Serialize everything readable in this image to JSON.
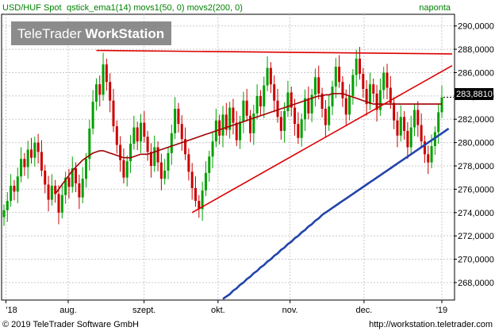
{
  "header": {
    "instrument": "USD/HUF Spot",
    "indicators": "qstick_ema1(14) movs1(50, 0) movs2(200, 0)",
    "period": "naponta"
  },
  "watermark": {
    "brand_light": "TeleTrader ",
    "brand_bold": "WorkStation"
  },
  "footer": {
    "copyright": "© 2019 TeleTrader Software GmbH",
    "url": "http://workstation.teletrader.com"
  },
  "colors": {
    "up_candle": "#00a000",
    "down_candle": "#cc0000",
    "ma50": "#a00000",
    "ma200": "#2244aa",
    "trendline": "#dd0000",
    "grid": "#c8c8c8"
  },
  "chart_data": {
    "type": "candlestick",
    "x_tick_labels": [
      "'18",
      "aug.",
      "szept.",
      "okt.",
      "nov.",
      "dec.",
      "'19"
    ],
    "y_tick_labels": [
      "290,0000",
      "288,0000",
      "286,0000",
      "284,0000",
      "282,0000",
      "280,0000",
      "278,0000",
      "276,0000",
      "274,0000",
      "272,0000",
      "270,0000",
      "268,0000"
    ],
    "ylim": [
      266.5,
      291.0
    ],
    "grid": true,
    "last_price": 283.881,
    "last_price_label": "283,8810",
    "closes": [
      274.2,
      275.0,
      276.3,
      275.8,
      277.1,
      278.6,
      277.9,
      279.4,
      278.7,
      280.0,
      279.2,
      277.6,
      276.4,
      275.1,
      276.3,
      275.6,
      274.0,
      275.5,
      277.0,
      276.2,
      277.8,
      276.5,
      275.3,
      276.9,
      278.6,
      281.2,
      283.5,
      285.0,
      284.1,
      286.7,
      285.2,
      283.6,
      281.4,
      279.8,
      278.5,
      277.0,
      278.4,
      279.9,
      281.3,
      280.1,
      281.7,
      280.5,
      279.2,
      278.0,
      279.6,
      278.3,
      276.9,
      277.6,
      279.1,
      280.8,
      282.9,
      281.6,
      280.3,
      279.0,
      277.5,
      276.1,
      275.0,
      274.3,
      275.9,
      277.4,
      278.8,
      280.1,
      281.9,
      280.6,
      282.4,
      281.1,
      283.0,
      281.7,
      280.2,
      281.8,
      283.6,
      282.3,
      280.8,
      282.5,
      284.0,
      283.1,
      284.9,
      286.4,
      285.0,
      283.6,
      282.2,
      281.0,
      282.7,
      284.3,
      283.0,
      281.6,
      280.4,
      282.0,
      283.8,
      282.5,
      284.1,
      285.6,
      284.2,
      282.9,
      281.5,
      283.1,
      284.8,
      286.5,
      285.2,
      283.8,
      282.4,
      284.0,
      285.8,
      287.2,
      285.9,
      284.6,
      283.3,
      285.0,
      284.2,
      282.8,
      284.5,
      286.0,
      284.7,
      283.4,
      281.9,
      280.6,
      282.2,
      281.0,
      279.6,
      281.3,
      282.8,
      281.5,
      280.1,
      279.0,
      278.3,
      279.7,
      280.9,
      282.6,
      283.88
    ],
    "ma50": [
      null,
      null,
      null,
      null,
      null,
      null,
      null,
      null,
      null,
      null,
      null,
      null,
      null,
      null,
      null,
      275.6,
      276.0,
      276.4,
      276.8,
      277.2,
      277.6,
      277.9,
      278.2,
      278.5,
      278.7,
      278.9,
      279.1,
      279.2,
      279.3,
      279.3,
      279.2,
      279.1,
      279.0,
      278.9,
      278.8,
      278.7,
      278.7,
      278.7,
      278.8,
      278.9,
      279.0,
      279.0,
      279.0,
      279.1,
      279.2,
      279.3,
      279.4,
      279.5,
      279.6,
      279.7,
      279.8,
      279.9,
      280.0,
      280.1,
      280.2,
      280.3,
      280.4,
      280.5,
      280.6,
      280.7,
      280.8,
      280.9,
      281.0,
      281.1,
      281.2,
      281.3,
      281.4,
      281.5,
      281.6,
      281.7,
      281.8,
      281.9,
      282.0,
      282.1,
      282.2,
      282.3,
      282.4,
      282.5,
      282.6,
      282.7,
      282.8,
      282.9,
      283.0,
      283.1,
      283.2,
      283.3,
      283.4,
      283.5,
      283.6,
      283.7,
      283.8,
      283.9,
      284.0,
      284.0,
      284.1,
      284.1,
      284.2,
      284.2,
      284.2,
      284.2,
      284.1,
      284.0,
      283.9,
      283.8,
      283.7,
      283.6,
      283.5,
      283.4,
      283.3,
      283.3,
      283.3,
      283.3,
      283.3,
      283.3,
      283.3,
      283.3,
      283.3,
      283.3,
      283.3,
      283.3,
      283.3,
      283.3,
      283.3,
      283.3,
      283.3,
      283.3,
      283.3,
      283.3,
      283.3
    ],
    "ma200": [
      null,
      null,
      null,
      null,
      null,
      null,
      null,
      null,
      null,
      null,
      null,
      null,
      null,
      null,
      null,
      null,
      null,
      null,
      null,
      null,
      null,
      null,
      null,
      null,
      null,
      null,
      null,
      null,
      null,
      null,
      null,
      null,
      null,
      null,
      null,
      null,
      null,
      null,
      null,
      null,
      null,
      null,
      null,
      null,
      null,
      null,
      null,
      null,
      null,
      null,
      null,
      null,
      null,
      null,
      null,
      null,
      null,
      null,
      null,
      null,
      null,
      null,
      null,
      null,
      266.6,
      266.8,
      267.0,
      267.3,
      267.5,
      267.8,
      268.0,
      268.3,
      268.5,
      268.8,
      269.0,
      269.3,
      269.5,
      269.8,
      270.0,
      270.3,
      270.5,
      270.8,
      271.0,
      271.3,
      271.5,
      271.8,
      272.0,
      272.3,
      272.5,
      272.8,
      273.0,
      273.3,
      273.5,
      273.8,
      274.0,
      274.2,
      274.4,
      274.6,
      274.8,
      275.0,
      275.2,
      275.4,
      275.6,
      275.8,
      276.0,
      276.2,
      276.4,
      276.6,
      276.8,
      277.0,
      277.2,
      277.4,
      277.6,
      277.8,
      278.0,
      278.2,
      278.4,
      278.6,
      278.8,
      279.0,
      279.2,
      279.4,
      279.6,
      279.8,
      280.0,
      280.2,
      280.4,
      280.6,
      280.8,
      281.0,
      281.2
    ],
    "trendlines": [
      {
        "from": [
          27,
          287.9
        ],
        "to": [
          131,
          287.6
        ]
      },
      {
        "from": [
          55,
          274.0
        ],
        "to": [
          131,
          286.6
        ]
      }
    ]
  }
}
